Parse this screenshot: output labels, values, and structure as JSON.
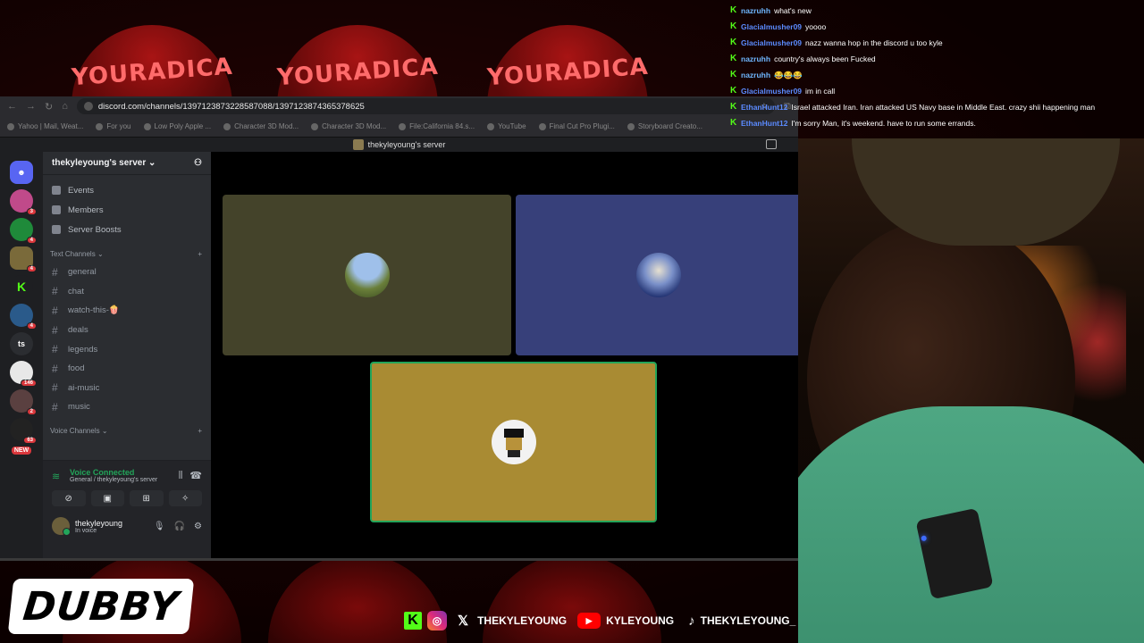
{
  "browser": {
    "url": "discord.com/channels/1397123873228587088/1397123874365378625",
    "bookmarks": [
      "Yahoo | Mail, Weat...",
      "For you",
      "Low Poly Apple ...",
      "Character 3D Mod...",
      "Character 3D Mod...",
      "File:California 84.s...",
      "YouTube",
      "Final Cut Pro Plugi...",
      "Storyboard Creato..."
    ]
  },
  "window_title": "thekyleyoung's server",
  "server": {
    "name": "thekyleyoung's server",
    "menu": [
      {
        "label": "Events",
        "icon": "calendar-icon"
      },
      {
        "label": "Members",
        "icon": "members-icon"
      },
      {
        "label": "Server Boosts",
        "icon": "boost-icon"
      }
    ],
    "text_category": "Text Channels",
    "text_channels": [
      "general",
      "chat",
      "watch-this-🍿",
      "deals",
      "legends",
      "food",
      "ai-music",
      "music"
    ],
    "voice_category": "Voice Channels"
  },
  "rail": {
    "badges": [
      "3",
      "4",
      "4",
      "4",
      "146",
      "2",
      "63"
    ],
    "ts_label": "ts",
    "new_label": "NEW"
  },
  "voice": {
    "status": "Voice Connected",
    "location": "General / thekyleyoung's server",
    "user_name": "thekyleyoung",
    "user_status": "In voice"
  },
  "tiles": {
    "colors": [
      "#44432a",
      "#37407a",
      "#a98b33"
    ]
  },
  "chat": [
    {
      "user": "nazruhh",
      "color": "#6fb7ff",
      "text": "what's new"
    },
    {
      "user": "Glacialmusher09",
      "color": "#5b8bff",
      "text": "yoooo"
    },
    {
      "user": "Glacialmusher09",
      "color": "#5b8bff",
      "text": "nazz wanna hop in the discord u too kyle"
    },
    {
      "user": "nazruhh",
      "color": "#6fb7ff",
      "text": "country's always been Fucked"
    },
    {
      "user": "nazruhh",
      "color": "#6fb7ff",
      "text": "😂😂😂"
    },
    {
      "user": "Glacialmusher09",
      "color": "#5b8bff",
      "text": "im in call"
    },
    {
      "user": "EthanHunt12",
      "color": "#5b8bff",
      "text": "Israel attacked Iran. Iran attacked US Navy base in Middle East. crazy shii happening man"
    },
    {
      "user": "EthanHunt12",
      "color": "#5b8bff",
      "text": "I'm sorry Man, it's weekend. have to run some errands."
    }
  ],
  "overlay": {
    "cap_text": "YOURADICA",
    "brand": "DUBBY",
    "x_handle": "THEKYLEYOUNG",
    "youtube_handle": "KYLEYOUNG",
    "tiktok_handle": "THEKYLEYOUNG_"
  }
}
